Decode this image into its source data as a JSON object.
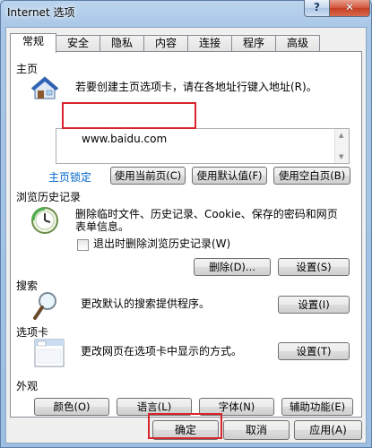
{
  "window": {
    "title": "Internet 选项",
    "help_label": "?",
    "close_label": "✕"
  },
  "tabs": [
    {
      "label": "常规",
      "active": true
    },
    {
      "label": "安全"
    },
    {
      "label": "隐私"
    },
    {
      "label": "内容"
    },
    {
      "label": "连接"
    },
    {
      "label": "程序"
    },
    {
      "label": "高级"
    }
  ],
  "home": {
    "label": "主页",
    "description": "若要创建主页选项卡，请在各地址行键入地址(R)。",
    "url": "www.baidu.com",
    "locked_link": "主页锁定",
    "use_current": "使用当前页(C)",
    "use_default": "使用默认值(F)",
    "use_blank": "使用空白页(B)"
  },
  "history": {
    "label": "浏览历史记录",
    "description_line1": "删除临时文件、历史记录、Cookie、保存的密码和网页",
    "description_line2": "表单信息。",
    "checkbox_label": "退出时删除浏览历史记录(W)",
    "delete_button": "删除(D)...",
    "settings_button": "设置(S)"
  },
  "search": {
    "label": "搜索",
    "description": "更改默认的搜索提供程序。",
    "settings_button": "设置(I)"
  },
  "tabs_group": {
    "label": "选项卡",
    "description": "更改网页在选项卡中显示的方式。",
    "settings_button": "设置(T)"
  },
  "appearance": {
    "label": "外观",
    "colors": "颜色(O)",
    "languages": "语言(L)",
    "fonts": "字体(N)",
    "accessibility": "辅助功能(E)"
  },
  "footer": {
    "ok": "确定",
    "cancel": "取消",
    "apply": "应用(A)"
  },
  "colors": {
    "highlight_red": "#d9242b",
    "link_blue": "#0066cc"
  }
}
